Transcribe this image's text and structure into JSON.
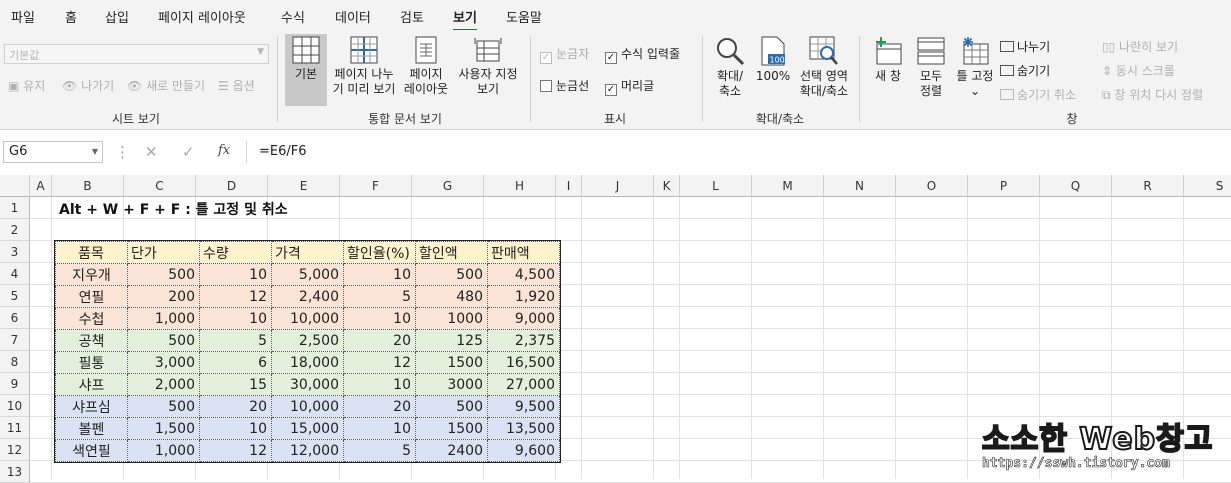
{
  "menu": [
    "파일",
    "홈",
    "삽입",
    "페이지 레이아웃",
    "수식",
    "데이터",
    "검토",
    "보기",
    "도움말"
  ],
  "active_menu": "보기",
  "ribbon": {
    "sheet_view": {
      "dropdown": "기본값",
      "keep": "유지",
      "exit": "나가기",
      "new": "새로 만들기",
      "options": "옵션",
      "title": "시트 보기"
    },
    "workbook_views": {
      "normal": "기본",
      "page_break_l1": "페이지 나누",
      "page_break_l2": "기 미리 보기",
      "page_layout_l1": "페이지",
      "page_layout_l2": "레이아웃",
      "custom_l1": "사용자 지정",
      "custom_l2": "보기",
      "title": "통합 문서 보기"
    },
    "show": {
      "ruler": "눈금자",
      "formula_bar": "수식 입력줄",
      "gridlines": "눈금선",
      "headings": "머리글",
      "title": "표시"
    },
    "zoom": {
      "zoom_l1": "확대/",
      "zoom_l2": "축소",
      "hundred": "100%",
      "hundred_icon": "100",
      "selection_l1": "선택 영역",
      "selection_l2": "확대/축소",
      "title": "확대/축소"
    },
    "window": {
      "new_window": "새 창",
      "arrange_l1": "모두",
      "arrange_l2": "정렬",
      "freeze": "틀 고정",
      "freeze_chev": "⌄",
      "split": "나누기",
      "hide": "숨기기",
      "unhide": "숨기기 취소",
      "side_by_side": "나란히 보기",
      "sync_scroll": "동시 스크롤",
      "reset_position": "창 위치 다시 정렬",
      "title": "창"
    }
  },
  "formula_bar": {
    "name_box": "G6",
    "formula": "=E6/F6",
    "cancel": "✕",
    "enter": "✓",
    "fx": "fx",
    "dots": "⋮"
  },
  "columns": [
    "A",
    "B",
    "C",
    "D",
    "E",
    "F",
    "G",
    "H",
    "I",
    "J",
    "K",
    "L",
    "M",
    "N",
    "O",
    "P",
    "Q",
    "R",
    "S"
  ],
  "rows": [
    "1",
    "2",
    "3",
    "4",
    "5",
    "6",
    "7",
    "8",
    "9",
    "10",
    "11",
    "12",
    "13"
  ],
  "sheet_title": "Alt + W + F + F : 틀 고정 및 취소",
  "table": {
    "headers": [
      "품목",
      "단가",
      "수량",
      "가격",
      "할인율(%)",
      "할인액",
      "판매액"
    ],
    "rows": [
      [
        "지우개",
        "500",
        "10",
        "5,000",
        "10",
        "500",
        "4,500"
      ],
      [
        "연필",
        "200",
        "12",
        "2,400",
        "5",
        "480",
        "1,920"
      ],
      [
        "수첩",
        "1,000",
        "10",
        "10,000",
        "10",
        "1000",
        "9,000"
      ],
      [
        "공책",
        "500",
        "5",
        "2,500",
        "20",
        "125",
        "2,375"
      ],
      [
        "필통",
        "3,000",
        "6",
        "18,000",
        "12",
        "1500",
        "16,500"
      ],
      [
        "샤프",
        "2,000",
        "15",
        "30,000",
        "10",
        "3000",
        "27,000"
      ],
      [
        "샤프심",
        "500",
        "20",
        "10,000",
        "20",
        "500",
        "9,500"
      ],
      [
        "볼펜",
        "1,500",
        "10",
        "15,000",
        "10",
        "1500",
        "13,500"
      ],
      [
        "색연필",
        "1,000",
        "12",
        "12,000",
        "5",
        "2400",
        "9,600"
      ]
    ]
  },
  "watermark": {
    "main": "소소한 Web창고",
    "url": "https://sswh.tistory.com"
  },
  "colors": {
    "accent": "#1e7145",
    "header_fill": "#fff2cc",
    "group1_fill": "#fbe3d6",
    "group2_fill": "#e2efda",
    "group3_fill": "#dae3f3"
  }
}
